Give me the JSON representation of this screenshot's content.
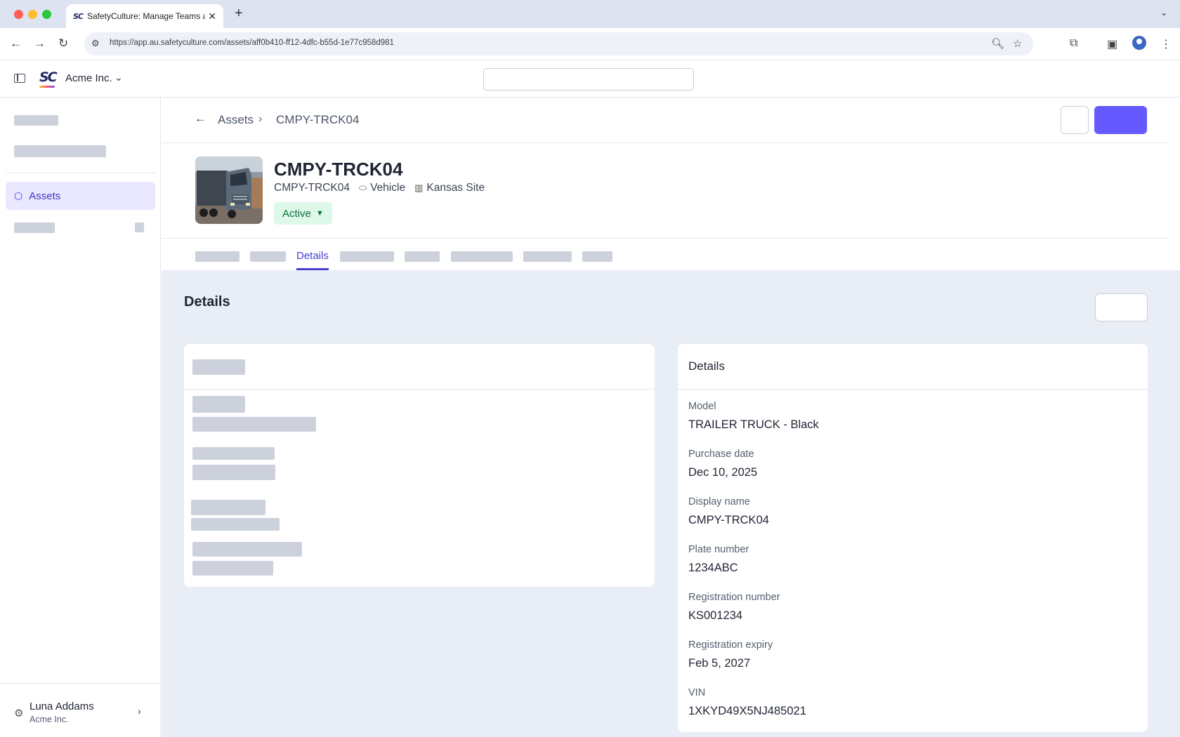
{
  "browser": {
    "tab_title": "SafetyCulture: Manage Teams and...",
    "tab_favicon": "SC",
    "url": "https://app.au.safetyculture.com/assets/aff0b410-ff12-4dfc-b55d-1e77c958d981"
  },
  "header": {
    "logo": "SC",
    "org_name": "Acme Inc.",
    "search_placeholder": ""
  },
  "sidebar": {
    "active_item": "Assets",
    "user": {
      "name": "Luna Addams",
      "org": "Acme Inc."
    }
  },
  "breadcrumb": {
    "parent": "Assets",
    "current": "CMPY-TRCK04"
  },
  "asset": {
    "title": "CMPY-TRCK04",
    "id": "CMPY-TRCK04",
    "type": "Vehicle",
    "site": "Kansas Site",
    "status": "Active"
  },
  "tabs": {
    "active": "Details"
  },
  "section_title": "Details",
  "details_card": {
    "title": "Details",
    "fields": [
      {
        "label": "Model",
        "value": "TRAILER TRUCK - Black"
      },
      {
        "label": "Purchase date",
        "value": "Dec 10, 2025"
      },
      {
        "label": "Display name",
        "value": "CMPY-TRCK04"
      },
      {
        "label": "Plate number",
        "value": "1234ABC"
      },
      {
        "label": "Registration number",
        "value": "KS001234"
      },
      {
        "label": "Registration expiry",
        "value": "Feb 5, 2027"
      },
      {
        "label": "VIN",
        "value": "1XKYD49X5NJ485021"
      }
    ]
  },
  "colors": {
    "accent": "#6559ff",
    "active_nav_bg": "#e9e8ff",
    "status_bg": "#def8e9",
    "status_text": "#0c6f3e",
    "page_bg": "#e9edf6"
  }
}
